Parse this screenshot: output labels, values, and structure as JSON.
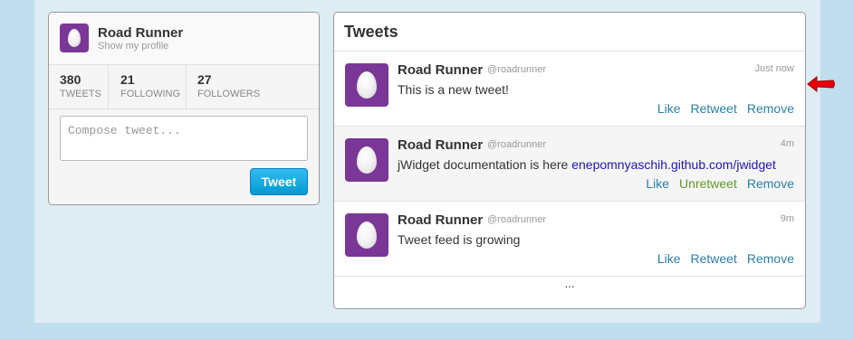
{
  "profile": {
    "name": "Road Runner",
    "show_profile": "Show my profile",
    "stats": [
      {
        "count": "380",
        "label": "Tweets"
      },
      {
        "count": "21",
        "label": "Following"
      },
      {
        "count": "27",
        "label": "Followers"
      }
    ],
    "compose_placeholder": "Compose tweet...",
    "tweet_button": "Tweet"
  },
  "feed": {
    "title": "Tweets",
    "tweets": [
      {
        "name": "Road Runner",
        "handle": "@roadrunner",
        "time": "Just now",
        "text": "This is a new tweet!",
        "link": "",
        "actions": [
          "Like",
          "Retweet",
          "Remove"
        ]
      },
      {
        "name": "Road Runner",
        "handle": "@roadrunner",
        "time": "4m",
        "text": "jWidget documentation is here ",
        "link": "enepomnyaschih.github.com/jwidget",
        "actions": [
          "Like",
          "Unretweet",
          "Remove"
        ]
      },
      {
        "name": "Road Runner",
        "handle": "@roadrunner",
        "time": "9m",
        "text": "Tweet feed is growing",
        "link": "",
        "actions": [
          "Like",
          "Retweet",
          "Remove"
        ]
      }
    ],
    "load_more": "..."
  },
  "colors": {
    "avatar": "#7b3797",
    "link": "#1e16b4",
    "action": "#2a7fa8",
    "unretweet": "#609928",
    "arrow": "#e8000a"
  },
  "icons": {
    "avatar": "egg-avatar-icon",
    "pointer": "red-arrow-icon"
  }
}
